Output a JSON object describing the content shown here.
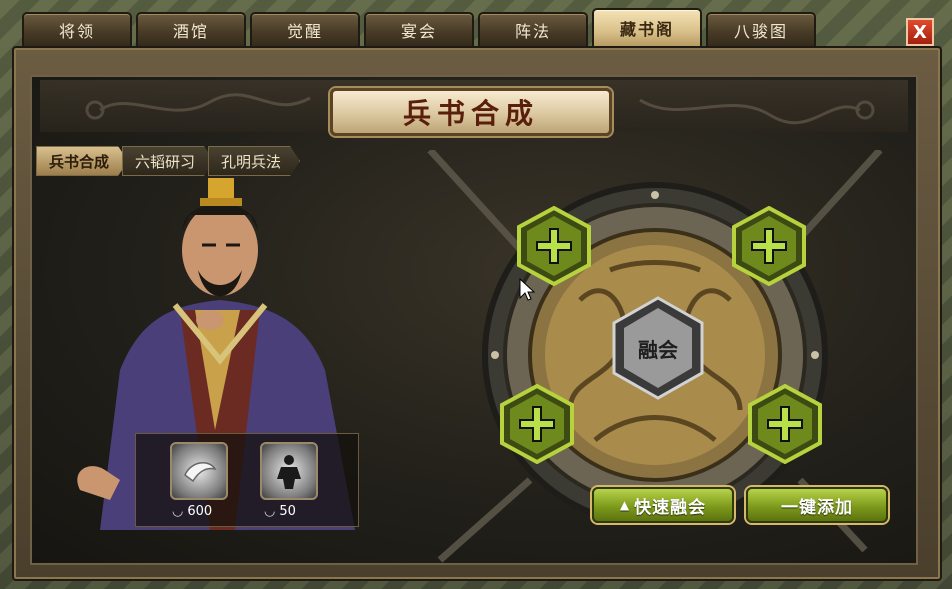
{
  "tabs": [
    {
      "label": "将领",
      "active": false
    },
    {
      "label": "酒馆",
      "active": false
    },
    {
      "label": "觉醒",
      "active": false
    },
    {
      "label": "宴会",
      "active": false
    },
    {
      "label": "阵法",
      "active": false
    },
    {
      "label": "藏书阁",
      "active": true
    },
    {
      "label": "八骏图",
      "active": false
    }
  ],
  "close_label": "X",
  "title": "兵书合成",
  "subtabs": [
    {
      "label": "兵书合成",
      "active": true
    },
    {
      "label": "六韬研习",
      "active": false
    },
    {
      "label": "孔明兵法",
      "active": false
    }
  ],
  "items": [
    {
      "icon": "silver-scroll-icon",
      "count": "600"
    },
    {
      "icon": "warrior-silhouette-icon",
      "count": "50"
    }
  ],
  "wheel": {
    "center_label": "融会",
    "slots": [
      "plus-icon",
      "plus-icon",
      "plus-icon",
      "plus-icon"
    ]
  },
  "buttons": {
    "quick_fuse": "快速融会",
    "one_click_add": "一键添加"
  },
  "colors": {
    "accent_green": "#8fb02a",
    "title_red": "#5a1f0c",
    "gold": "#d7b76a"
  }
}
